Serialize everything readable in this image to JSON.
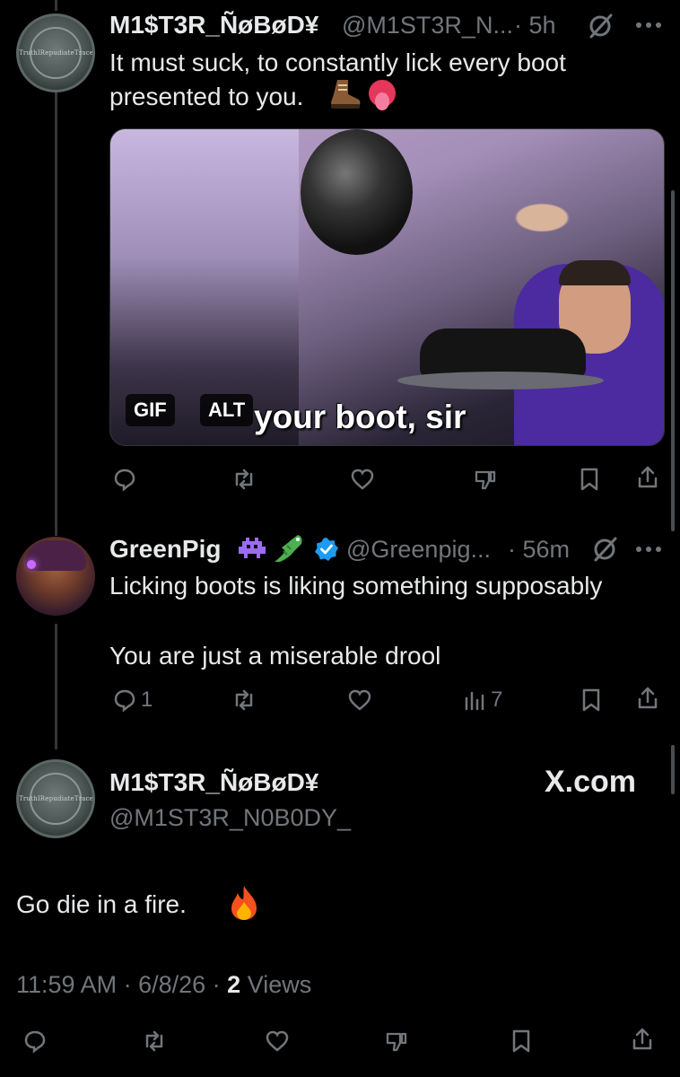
{
  "tweet1": {
    "name": "M1$T3R_ÑøBøD¥",
    "handle": "@M1ST3R_N...",
    "time": "· 5h",
    "text_line1": "It must suck, to constantly lick every boot",
    "text_line2": "presented to you.",
    "avatar_text": "TruthIRepudiateTrace",
    "media": {
      "caption": "your boot, sir",
      "gif_badge": "GIF",
      "alt_badge": "ALT"
    }
  },
  "tweet2": {
    "name": "GreenPig",
    "handle": "@Greenpig...",
    "time": "· 56m",
    "text_line1": "Licking boots is liking something supposably",
    "text_line2": "You are just a miserable drool",
    "reply_count": "1",
    "views_count": "7"
  },
  "main_tweet": {
    "name": "M1$T3R_ÑøBøD¥",
    "handle": "@M1ST3R_N0B0DY_",
    "avatar_text": "TruthIRepudiateTrace",
    "brand": "X.com",
    "text": "Go die in a fire.",
    "timestamp": "11:59 AM · 6/8/26 ·",
    "views_count": "2",
    "views_label": "Views"
  },
  "icons": {
    "reply": "reply-icon",
    "repost": "repost-icon",
    "like": "like-icon",
    "dislike": "dislike-icon",
    "views": "views-icon",
    "bookmark": "bookmark-icon",
    "share": "share-icon",
    "grok": "grok-icon",
    "more": "more-icon"
  },
  "colors": {
    "background": "#000000",
    "text": "#e7e9ea",
    "muted": "#71767b",
    "verified": "#1d9bf0"
  }
}
